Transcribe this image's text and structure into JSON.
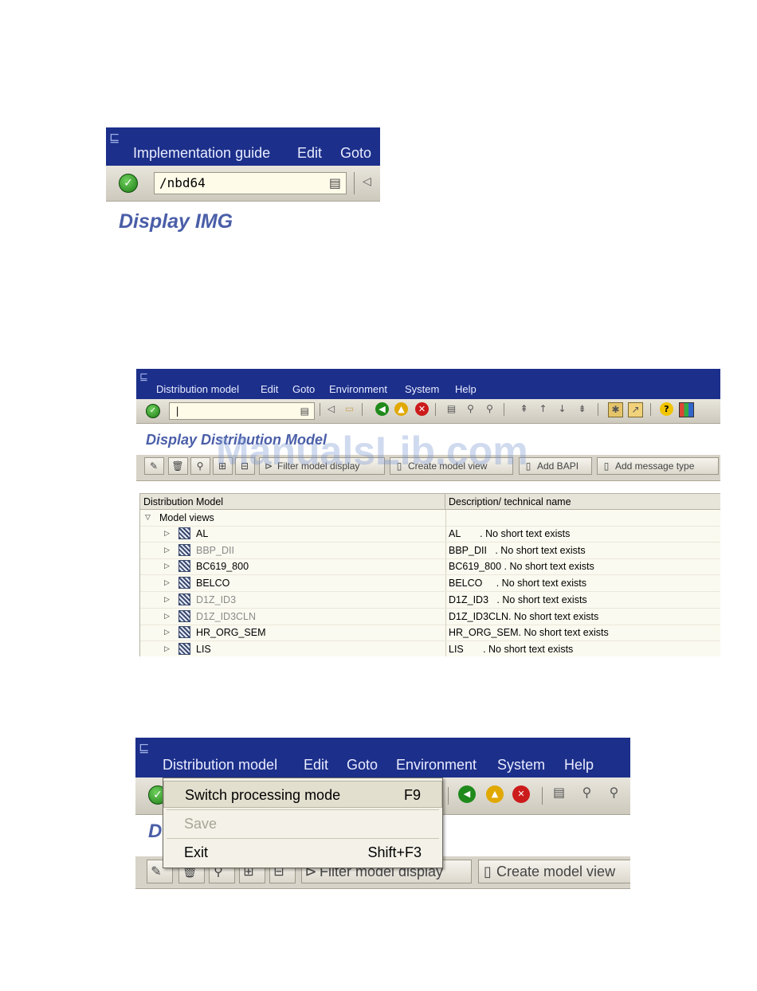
{
  "shot1": {
    "menu": [
      "Implementation guide",
      "Edit",
      "Goto"
    ],
    "command_value": "/nbd64",
    "title": "Display IMG"
  },
  "shot2": {
    "menu": [
      "Distribution model",
      "Edit",
      "Goto",
      "Environment",
      "System",
      "Help"
    ],
    "command_value": "|",
    "title": "Display Distribution Model",
    "app_buttons": [
      "Filter model display",
      "Create model view",
      "Add BAPI",
      "Add message type"
    ],
    "columns": [
      "Distribution Model",
      "Description/ technical name"
    ],
    "root_label": "Model views",
    "rows": [
      {
        "name": "AL",
        "desc": "AL       . No short text exists",
        "dim": false
      },
      {
        "name": "BBP_DII",
        "desc": "BBP_DII   . No short text exists",
        "dim": true
      },
      {
        "name": "BC619_800",
        "desc": "BC619_800 . No short text exists",
        "dim": false
      },
      {
        "name": "BELCO",
        "desc": "BELCO     . No short text exists",
        "dim": false
      },
      {
        "name": "D1Z_ID3",
        "desc": "D1Z_ID3   . No short text exists",
        "dim": true
      },
      {
        "name": "D1Z_ID3CLN",
        "desc": "D1Z_ID3CLN. No short text exists",
        "dim": true
      },
      {
        "name": "HR_ORG_SEM",
        "desc": "HR_ORG_SEM. No short text exists",
        "dim": false
      },
      {
        "name": "LIS",
        "desc": "LIS       . No short text exists",
        "dim": false
      }
    ]
  },
  "shot3": {
    "menu": [
      "Distribution model",
      "Edit",
      "Goto",
      "Environment",
      "System",
      "Help"
    ],
    "title_partial": "D",
    "app_buttons": [
      "Filter model display",
      "Create model view"
    ],
    "dropdown": [
      {
        "label": "Switch processing mode",
        "key": "F9",
        "disabled": false,
        "highlighted": true
      },
      {
        "label": "Save",
        "key": "",
        "disabled": true,
        "highlighted": false
      },
      {
        "label": "Exit",
        "key": "Shift+F3",
        "disabled": false,
        "highlighted": false
      }
    ]
  },
  "watermark": "ManualsLib.com",
  "colors": {
    "menubar": "#1c2f8a",
    "title": "#4a5ea8",
    "tree_bg": "#fbfaf0"
  }
}
